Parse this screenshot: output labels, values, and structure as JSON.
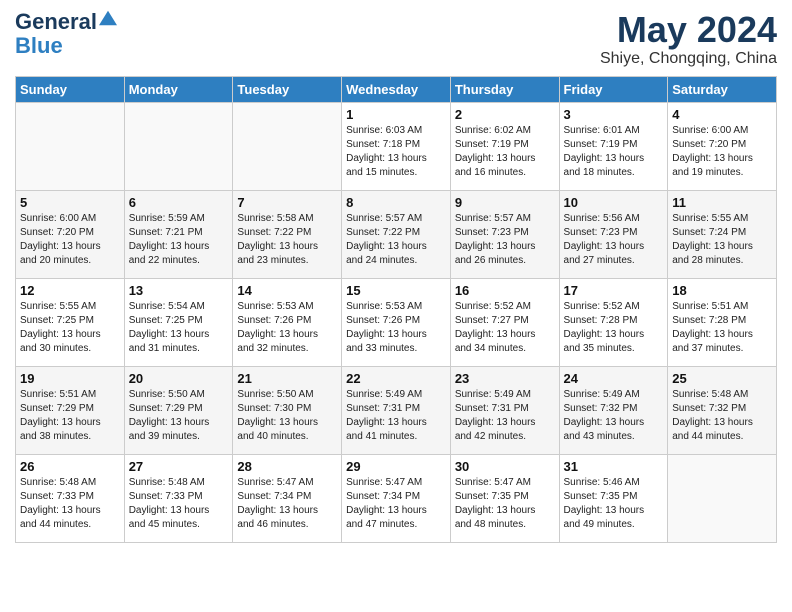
{
  "logo": {
    "line1": "General",
    "line2": "Blue"
  },
  "title": "May 2024",
  "subtitle": "Shiye, Chongqing, China",
  "weekdays": [
    "Sunday",
    "Monday",
    "Tuesday",
    "Wednesday",
    "Thursday",
    "Friday",
    "Saturday"
  ],
  "weeks": [
    [
      {
        "day": "",
        "info": ""
      },
      {
        "day": "",
        "info": ""
      },
      {
        "day": "",
        "info": ""
      },
      {
        "day": "1",
        "info": "Sunrise: 6:03 AM\nSunset: 7:18 PM\nDaylight: 13 hours and 15 minutes."
      },
      {
        "day": "2",
        "info": "Sunrise: 6:02 AM\nSunset: 7:19 PM\nDaylight: 13 hours and 16 minutes."
      },
      {
        "day": "3",
        "info": "Sunrise: 6:01 AM\nSunset: 7:19 PM\nDaylight: 13 hours and 18 minutes."
      },
      {
        "day": "4",
        "info": "Sunrise: 6:00 AM\nSunset: 7:20 PM\nDaylight: 13 hours and 19 minutes."
      }
    ],
    [
      {
        "day": "5",
        "info": "Sunrise: 6:00 AM\nSunset: 7:20 PM\nDaylight: 13 hours and 20 minutes."
      },
      {
        "day": "6",
        "info": "Sunrise: 5:59 AM\nSunset: 7:21 PM\nDaylight: 13 hours and 22 minutes."
      },
      {
        "day": "7",
        "info": "Sunrise: 5:58 AM\nSunset: 7:22 PM\nDaylight: 13 hours and 23 minutes."
      },
      {
        "day": "8",
        "info": "Sunrise: 5:57 AM\nSunset: 7:22 PM\nDaylight: 13 hours and 24 minutes."
      },
      {
        "day": "9",
        "info": "Sunrise: 5:57 AM\nSunset: 7:23 PM\nDaylight: 13 hours and 26 minutes."
      },
      {
        "day": "10",
        "info": "Sunrise: 5:56 AM\nSunset: 7:23 PM\nDaylight: 13 hours and 27 minutes."
      },
      {
        "day": "11",
        "info": "Sunrise: 5:55 AM\nSunset: 7:24 PM\nDaylight: 13 hours and 28 minutes."
      }
    ],
    [
      {
        "day": "12",
        "info": "Sunrise: 5:55 AM\nSunset: 7:25 PM\nDaylight: 13 hours and 30 minutes."
      },
      {
        "day": "13",
        "info": "Sunrise: 5:54 AM\nSunset: 7:25 PM\nDaylight: 13 hours and 31 minutes."
      },
      {
        "day": "14",
        "info": "Sunrise: 5:53 AM\nSunset: 7:26 PM\nDaylight: 13 hours and 32 minutes."
      },
      {
        "day": "15",
        "info": "Sunrise: 5:53 AM\nSunset: 7:26 PM\nDaylight: 13 hours and 33 minutes."
      },
      {
        "day": "16",
        "info": "Sunrise: 5:52 AM\nSunset: 7:27 PM\nDaylight: 13 hours and 34 minutes."
      },
      {
        "day": "17",
        "info": "Sunrise: 5:52 AM\nSunset: 7:28 PM\nDaylight: 13 hours and 35 minutes."
      },
      {
        "day": "18",
        "info": "Sunrise: 5:51 AM\nSunset: 7:28 PM\nDaylight: 13 hours and 37 minutes."
      }
    ],
    [
      {
        "day": "19",
        "info": "Sunrise: 5:51 AM\nSunset: 7:29 PM\nDaylight: 13 hours and 38 minutes."
      },
      {
        "day": "20",
        "info": "Sunrise: 5:50 AM\nSunset: 7:29 PM\nDaylight: 13 hours and 39 minutes."
      },
      {
        "day": "21",
        "info": "Sunrise: 5:50 AM\nSunset: 7:30 PM\nDaylight: 13 hours and 40 minutes."
      },
      {
        "day": "22",
        "info": "Sunrise: 5:49 AM\nSunset: 7:31 PM\nDaylight: 13 hours and 41 minutes."
      },
      {
        "day": "23",
        "info": "Sunrise: 5:49 AM\nSunset: 7:31 PM\nDaylight: 13 hours and 42 minutes."
      },
      {
        "day": "24",
        "info": "Sunrise: 5:49 AM\nSunset: 7:32 PM\nDaylight: 13 hours and 43 minutes."
      },
      {
        "day": "25",
        "info": "Sunrise: 5:48 AM\nSunset: 7:32 PM\nDaylight: 13 hours and 44 minutes."
      }
    ],
    [
      {
        "day": "26",
        "info": "Sunrise: 5:48 AM\nSunset: 7:33 PM\nDaylight: 13 hours and 44 minutes."
      },
      {
        "day": "27",
        "info": "Sunrise: 5:48 AM\nSunset: 7:33 PM\nDaylight: 13 hours and 45 minutes."
      },
      {
        "day": "28",
        "info": "Sunrise: 5:47 AM\nSunset: 7:34 PM\nDaylight: 13 hours and 46 minutes."
      },
      {
        "day": "29",
        "info": "Sunrise: 5:47 AM\nSunset: 7:34 PM\nDaylight: 13 hours and 47 minutes."
      },
      {
        "day": "30",
        "info": "Sunrise: 5:47 AM\nSunset: 7:35 PM\nDaylight: 13 hours and 48 minutes."
      },
      {
        "day": "31",
        "info": "Sunrise: 5:46 AM\nSunset: 7:35 PM\nDaylight: 13 hours and 49 minutes."
      },
      {
        "day": "",
        "info": ""
      }
    ]
  ]
}
